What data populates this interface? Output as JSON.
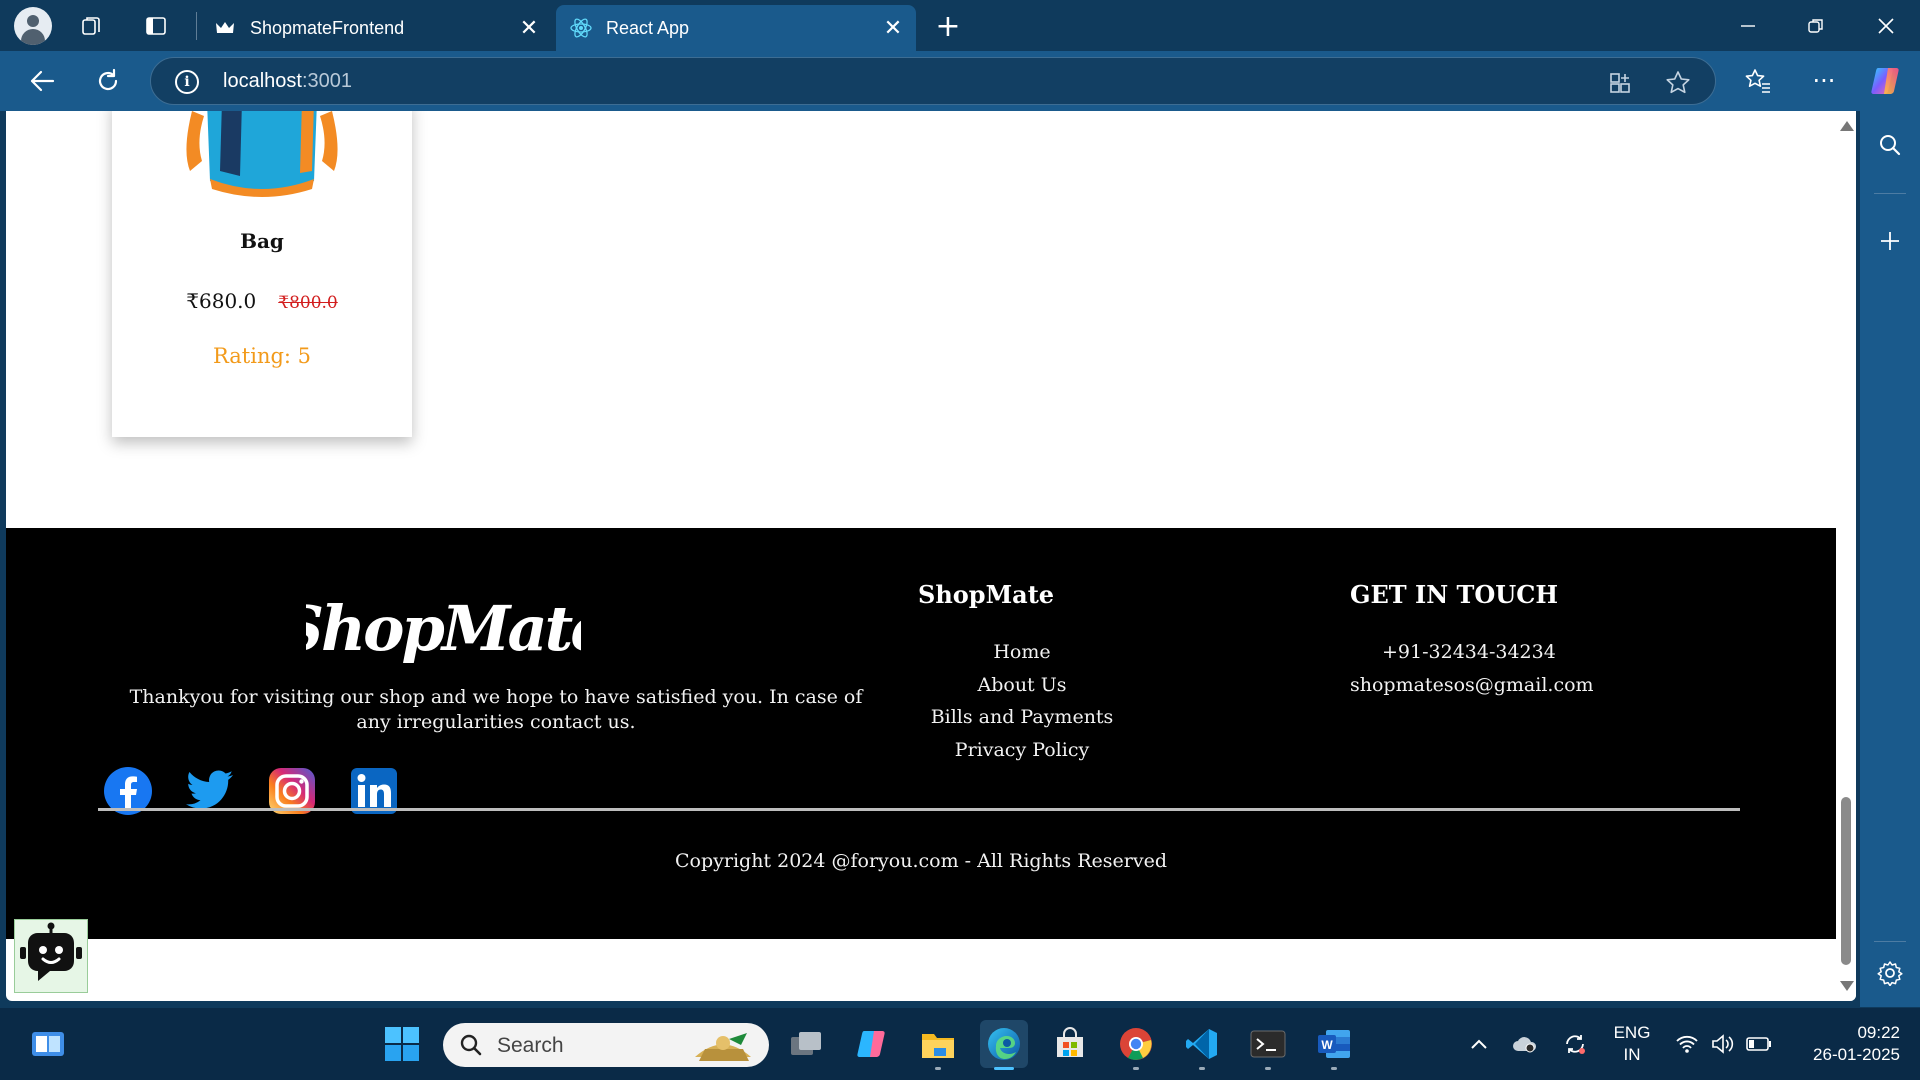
{
  "browser": {
    "tabs": [
      {
        "label": "ShopmateFrontend"
      },
      {
        "label": "React App"
      }
    ],
    "address": {
      "host": "localhost",
      "port": ":3001"
    }
  },
  "product": {
    "name": "Bag",
    "price": "₹680.0",
    "original_price": "₹800.0",
    "rating": "Rating: 5"
  },
  "footer": {
    "logo_text": "ShopMate",
    "description": "Thankyou for visiting our shop and we hope to have satisfied you. In case of any irregularities contact us.",
    "socials": [
      "facebook-icon",
      "twitter-icon",
      "instagram-icon",
      "linkedin-icon"
    ],
    "links_title": "ShopMate",
    "links": [
      "Home",
      "About Us",
      "Bills and Payments",
      "Privacy Policy"
    ],
    "contact_title": "GET IN TOUCH",
    "phone": "+91-32434-34234",
    "email": "shopmatesos@gmail.com",
    "copyright": "Copyright 2024 @foryou.com - All Rights Reserved"
  },
  "taskbar": {
    "search_placeholder": "Search",
    "lang_line1": "ENG",
    "lang_line2": "IN",
    "time": "09:22",
    "date": "26-01-2025"
  },
  "colors": {
    "rating": "#f29a1a",
    "strike_price": "#d21d1d",
    "footer_bg": "#000000",
    "browser_frame": "#1a5a8c"
  }
}
